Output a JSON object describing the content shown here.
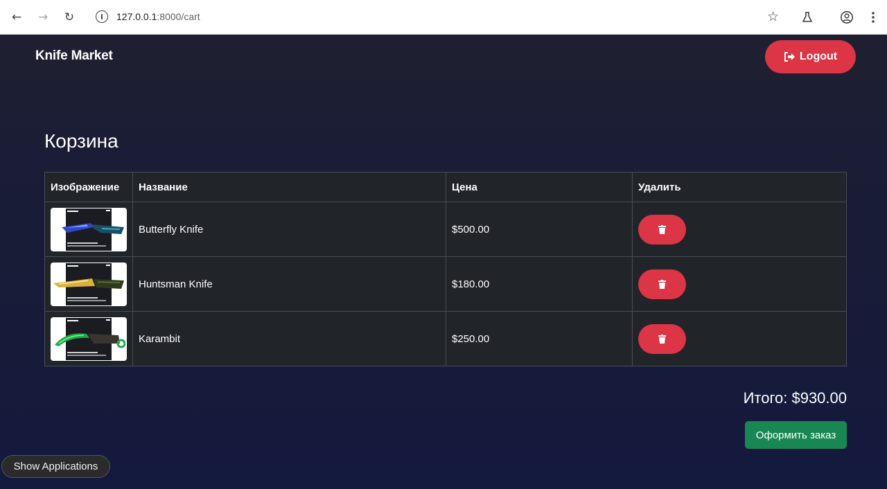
{
  "browser": {
    "url_host": "127.0.0.1",
    "url_path": ":8000/cart",
    "icons": [
      "back-icon",
      "forward-icon",
      "reload-icon",
      "site-info-icon",
      "bookmark-star-icon",
      "labs-flask-icon",
      "profile-icon",
      "menu-dots-icon"
    ]
  },
  "navbar": {
    "brand": "Knife Market",
    "logout_label": "Logout"
  },
  "cart": {
    "title": "Корзина",
    "headers": [
      "Изображение",
      "Название",
      "Цена",
      "Удалить"
    ],
    "items": [
      {
        "name": "Butterfly Knife",
        "price": "$500.00",
        "image": "butterfly-knife-image"
      },
      {
        "name": "Huntsman Knife",
        "price": "$180.00",
        "image": "huntsman-knife-image"
      },
      {
        "name": "Karambit",
        "price": "$250.00",
        "image": "karambit-image"
      }
    ],
    "total": "Итого: $930.00",
    "checkout_label": "Оформить заказ"
  },
  "taskbar": {
    "show_apps_label": "Show Applications"
  },
  "colors": {
    "danger": "#dc3545",
    "success": "#198754",
    "navbar": "#1e1f30",
    "table_bg": "#212429"
  }
}
